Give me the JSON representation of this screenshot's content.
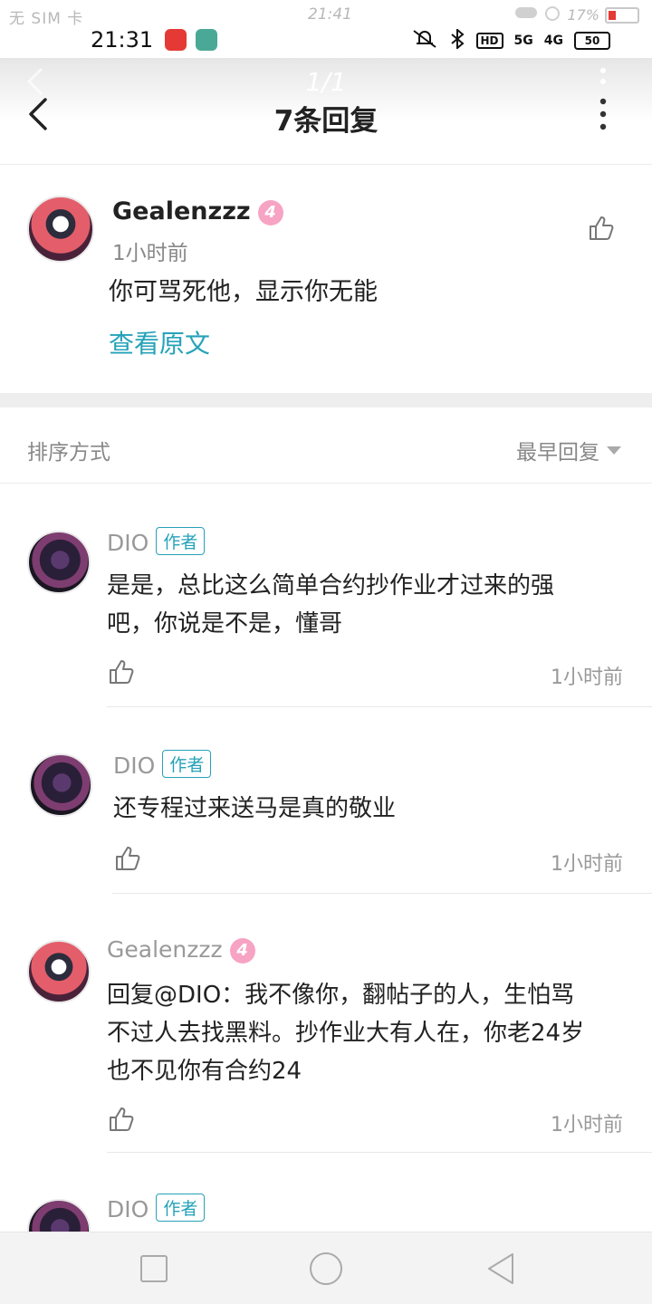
{
  "ghost_status": {
    "sim": "无 SIM 卡",
    "time": "21:41",
    "battery_pct": "17%"
  },
  "status": {
    "time": "21:31",
    "hd": "HD",
    "net1": "5G",
    "net2": "4G",
    "battery": "50"
  },
  "header": {
    "title": "7条回复",
    "ghost_page": "1/1"
  },
  "post": {
    "user": "Gealenzzz",
    "level": "4",
    "time": "1小时前",
    "text": "你可骂死他，显示你无能",
    "view_original": "查看原文"
  },
  "sort": {
    "label": "排序方式",
    "order": "最早回复"
  },
  "replies": [
    {
      "user": "DIO",
      "tag": "作者",
      "line1": "是是，总比这么简单合约抄作业才过来的强",
      "line2": "吧，你说是不是，懂哥",
      "time": "1小时前"
    },
    {
      "user": "DIO",
      "tag": "作者",
      "line1": "还专程过来送马是真的敬业",
      "time": "1小时前"
    },
    {
      "user": "Gealenzzz",
      "level": "4",
      "line1": "回复@DIO：我不像你，翻帖子的人，生怕骂",
      "line2": "不过人去找黑料。抄作业大有人在，你老24岁",
      "line3": "也不见你有合约24",
      "time": "1小时前"
    },
    {
      "user": "DIO",
      "tag": "作者"
    }
  ]
}
